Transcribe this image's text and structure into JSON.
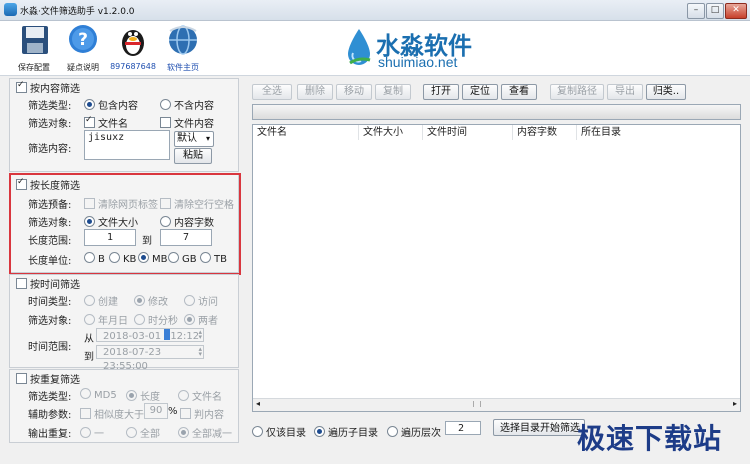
{
  "window": {
    "title": "水淼·文件筛选助手 v1.2.0.0"
  },
  "toolbar": {
    "save": "保存配置",
    "help": "疑点说明",
    "qq": "897687648",
    "home": "软件主页",
    "logo_cn": "水淼软件",
    "logo_en": "shuimiao.net"
  },
  "content_filter": {
    "header": "按内容筛选",
    "type_label": "筛选类型:",
    "type_options": [
      "包含内容",
      "不含内容"
    ],
    "target_label": "筛选对象:",
    "target_options": [
      "文件名",
      "文件内容"
    ],
    "content_label": "筛选内容:",
    "content_value": "jisuxz",
    "default_select": "默认",
    "paste": "粘贴"
  },
  "length_filter": {
    "header": "按长度筛选",
    "preset_label": "筛选预备:",
    "preset_options": [
      "清除网页标签",
      "清除空行空格"
    ],
    "target_label": "筛选对象:",
    "target_options": [
      "文件大小",
      "内容字数"
    ],
    "range_label": "长度范围:",
    "range_from": "1",
    "range_to_label": "到",
    "range_to": "7",
    "unit_label": "长度单位:",
    "units": [
      "B",
      "KB",
      "MB",
      "GB",
      "TB"
    ]
  },
  "time_filter": {
    "header": "按时间筛选",
    "type_label": "时间类型:",
    "type_options": [
      "创建",
      "修改",
      "访问"
    ],
    "target_label": "筛选对象:",
    "target_options": [
      "年月日",
      "时分秒",
      "两者"
    ],
    "range_label": "时间范围:",
    "from_label": "从",
    "from_date": "2018-03-01",
    "from_time": "12:12",
    "to_label": "到",
    "to_value": "2018-07-23 23:55:00"
  },
  "dup_filter": {
    "header": "按重复筛选",
    "type_label": "筛选类型:",
    "type_options": [
      "MD5",
      "长度",
      "文件名"
    ],
    "aux_label": "辅助参数:",
    "similar_label": "相似度大于",
    "similar_value": "90",
    "percent": "%",
    "judge_content": "判内容",
    "output_label": "输出重复:",
    "output_options": [
      "一",
      "全部",
      "全部减一"
    ]
  },
  "actions": {
    "select_all": "全选",
    "delete": "删除",
    "move": "移动",
    "copy": "复制",
    "open": "打开",
    "locate": "定位",
    "view": "查看",
    "copy_path": "复制路径",
    "export": "导出",
    "classify": "归类.."
  },
  "table": {
    "columns": [
      "文件名",
      "文件大小",
      "文件时间",
      "内容字数",
      "所在目录"
    ]
  },
  "bottom": {
    "scope_options": [
      "仅该目录",
      "遍历子目录",
      "遍历层次"
    ],
    "depth": "2",
    "start_button": "选择目录开始筛选"
  },
  "watermark": "极速下载站"
}
